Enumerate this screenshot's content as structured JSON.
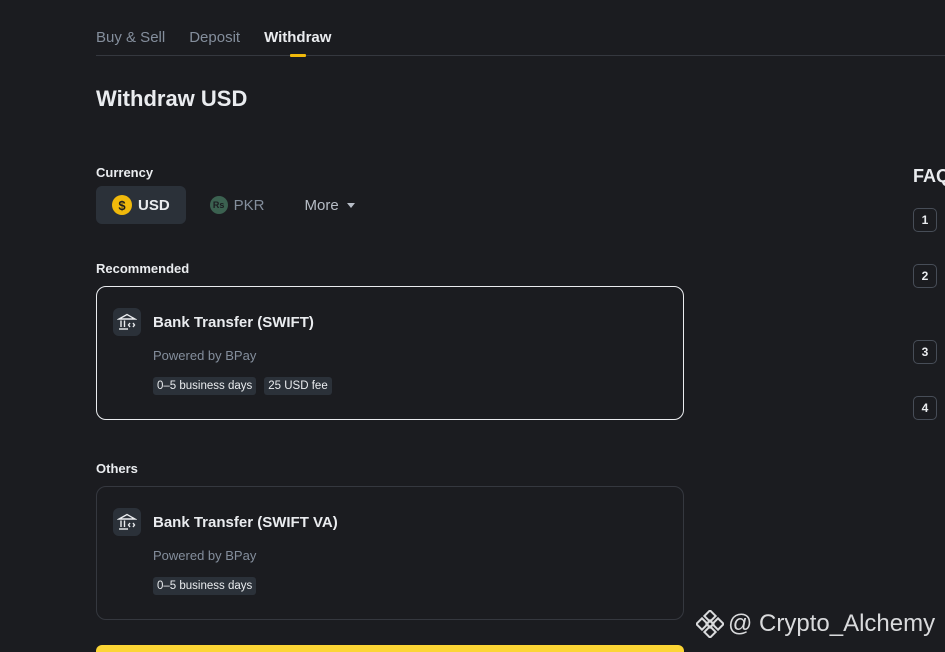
{
  "tabs": [
    {
      "label": "Buy & Sell"
    },
    {
      "label": "Deposit"
    },
    {
      "label": "Withdraw",
      "active": true
    }
  ],
  "page_title": "Withdraw USD",
  "currency": {
    "label": "Currency",
    "options": [
      {
        "code": "USD",
        "icon": "dollar-coin-icon",
        "symbol": "$",
        "selected": true
      },
      {
        "code": "PKR",
        "icon": "rupee-coin-icon",
        "symbol": "Rs",
        "selected": false
      }
    ],
    "more_label": "More"
  },
  "recommended": {
    "label": "Recommended",
    "method": {
      "name": "Bank Transfer (SWIFT)",
      "provider": "Powered by BPay",
      "tags": [
        "0–5 business days",
        "25 USD fee"
      ],
      "icon": "bank-icon"
    }
  },
  "others": {
    "label": "Others",
    "method": {
      "name": "Bank Transfer (SWIFT VA)",
      "provider": "Powered by BPay",
      "tags": [
        "0–5 business days"
      ],
      "icon": "bank-icon"
    }
  },
  "faq": {
    "title": "FAQ",
    "numbers": [
      "1",
      "2",
      "3",
      "4"
    ]
  },
  "watermark": {
    "text": "@ Crypto_Alchemy",
    "icon": "binance-logo-icon"
  },
  "colors": {
    "background": "#1b1c20",
    "accent": "#f0b90b",
    "button_yellow": "#fcd535",
    "muted_text": "#848e9c",
    "tag_bg": "#2b3139"
  }
}
